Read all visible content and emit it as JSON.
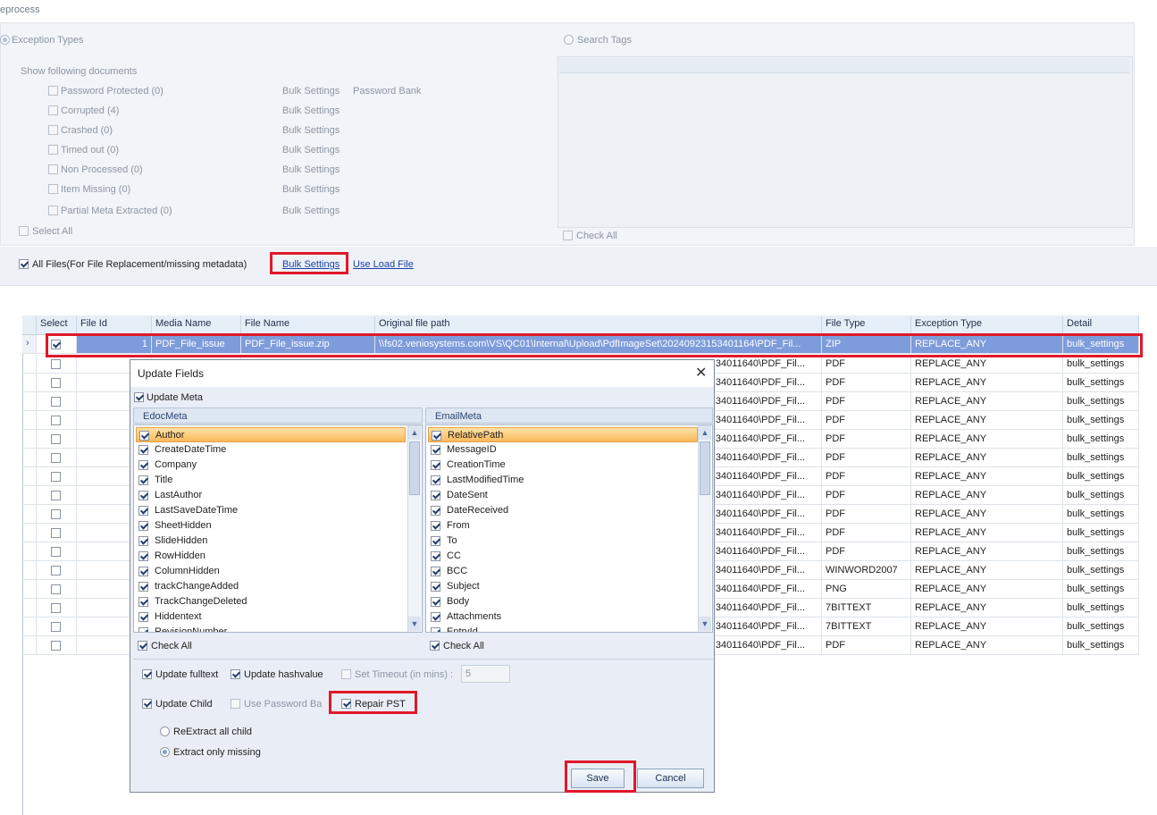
{
  "window": {
    "title": "eprocess"
  },
  "exception_panel": {
    "exception_types_label": "Exception Types",
    "search_tags_label": "Search Tags",
    "show_following": "Show following documents",
    "items": [
      {
        "label": "Password Protected (0)",
        "action": "Bulk Settings",
        "extra": "Password Bank"
      },
      {
        "label": "Corrupted (4)",
        "action": "Bulk Settings",
        "extra": ""
      },
      {
        "label": "Crashed (0)",
        "action": "Bulk Settings",
        "extra": ""
      },
      {
        "label": "Timed out (0)",
        "action": "Bulk Settings",
        "extra": ""
      },
      {
        "label": "Non Processed (0)",
        "action": "Bulk Settings",
        "extra": ""
      },
      {
        "label": "Item Missing (0)",
        "action": "Bulk Settings",
        "extra": ""
      },
      {
        "label": "Partial Meta Extracted (0)",
        "action": "Bulk Settings",
        "extra": ""
      }
    ],
    "select_all": "Select All",
    "check_all": "Check All"
  },
  "all_files_bar": {
    "all_files_label": "All Files(For File Replacement/missing metadata)",
    "bulk_settings": "Bulk Settings",
    "use_load_file": "Use Load File"
  },
  "grid": {
    "columns": [
      "Select",
      "File Id",
      "Media Name",
      "File Name",
      "Original file path",
      "File  Type",
      "Exception Type",
      "Detail"
    ],
    "first_row": {
      "file_id": "1",
      "media_name": "PDF_File_issue",
      "file_name": "PDF_File_issue.zip",
      "path": "\\\\fs02.veniosystems.com\\VS\\QC01\\Internal\\Upload\\PdfImageSet\\20240923153401164\\PDF_Fil...",
      "file_type": "ZIP",
      "exception_type": "REPLACE_ANY",
      "detail": "bulk_settings"
    },
    "rows": [
      {
        "path_tail": "34011640\\PDF_Fil...",
        "file_type": "PDF",
        "exception_type": "REPLACE_ANY",
        "detail": "bulk_settings"
      },
      {
        "path_tail": "34011640\\PDF_Fil...",
        "file_type": "PDF",
        "exception_type": "REPLACE_ANY",
        "detail": "bulk_settings"
      },
      {
        "path_tail": "34011640\\PDF_Fil...",
        "file_type": "PDF",
        "exception_type": "REPLACE_ANY",
        "detail": "bulk_settings"
      },
      {
        "path_tail": "34011640\\PDF_Fil...",
        "file_type": "PDF",
        "exception_type": "REPLACE_ANY",
        "detail": "bulk_settings"
      },
      {
        "path_tail": "34011640\\PDF_Fil...",
        "file_type": "PDF",
        "exception_type": "REPLACE_ANY",
        "detail": "bulk_settings"
      },
      {
        "path_tail": "34011640\\PDF_Fil...",
        "file_type": "PDF",
        "exception_type": "REPLACE_ANY",
        "detail": "bulk_settings"
      },
      {
        "path_tail": "34011640\\PDF_Fil...",
        "file_type": "PDF",
        "exception_type": "REPLACE_ANY",
        "detail": "bulk_settings"
      },
      {
        "path_tail": "34011640\\PDF_Fil...",
        "file_type": "PDF",
        "exception_type": "REPLACE_ANY",
        "detail": "bulk_settings"
      },
      {
        "path_tail": "34011640\\PDF_Fil...",
        "file_type": "PDF",
        "exception_type": "REPLACE_ANY",
        "detail": "bulk_settings"
      },
      {
        "path_tail": "34011640\\PDF_Fil...",
        "file_type": "PDF",
        "exception_type": "REPLACE_ANY",
        "detail": "bulk_settings"
      },
      {
        "path_tail": "34011640\\PDF_Fil...",
        "file_type": "PDF",
        "exception_type": "REPLACE_ANY",
        "detail": "bulk_settings"
      },
      {
        "path_tail": "34011640\\PDF_Fil...",
        "file_type": "WINWORD2007",
        "exception_type": "REPLACE_ANY",
        "detail": "bulk_settings"
      },
      {
        "path_tail": "34011640\\PDF_Fil...",
        "file_type": "PNG",
        "exception_type": "REPLACE_ANY",
        "detail": "bulk_settings"
      },
      {
        "path_tail": "34011640\\PDF_Fil...",
        "file_type": "7BITTEXT",
        "exception_type": "REPLACE_ANY",
        "detail": "bulk_settings"
      },
      {
        "path_tail": "34011640\\PDF_Fil...",
        "file_type": "7BITTEXT",
        "exception_type": "REPLACE_ANY",
        "detail": "bulk_settings"
      },
      {
        "path_tail": "34011640\\PDF_Fil...",
        "file_type": "PDF",
        "exception_type": "REPLACE_ANY",
        "detail": "bulk_settings"
      }
    ]
  },
  "dialog": {
    "title": "Update Fields",
    "update_meta": "Update Meta",
    "edoc_header": "EdocMeta",
    "email_header": "EmailMeta",
    "edoc_items": [
      "Author",
      "CreateDateTime",
      "Company",
      "Title",
      "LastAuthor",
      "LastSaveDateTime",
      "SheetHidden",
      "SlideHidden",
      "RowHidden",
      "ColumnHidden",
      "trackChangeAdded",
      "TrackChangeDeleted",
      "Hiddentext",
      "RevisionNumber"
    ],
    "email_items": [
      "RelativePath",
      "MessageID",
      "CreationTime",
      "LastModifiedTime",
      "DateSent",
      "DateReceived",
      "From",
      "To",
      "CC",
      "BCC",
      "Subject",
      "Body",
      "Attachments",
      "EntryId"
    ],
    "check_all": "Check All",
    "update_fulltext": "Update fulltext",
    "update_hashvalue": "Update hashvalue",
    "set_timeout": "Set Timeout (in mins) :",
    "timeout_value": "5",
    "update_child": "Update Child",
    "use_password_bank": "Use Password Ba",
    "repair_pst": "Repair PST",
    "reextract_all": "ReExtract all child",
    "extract_missing": "Extract only missing",
    "save": "Save",
    "cancel": "Cancel"
  }
}
